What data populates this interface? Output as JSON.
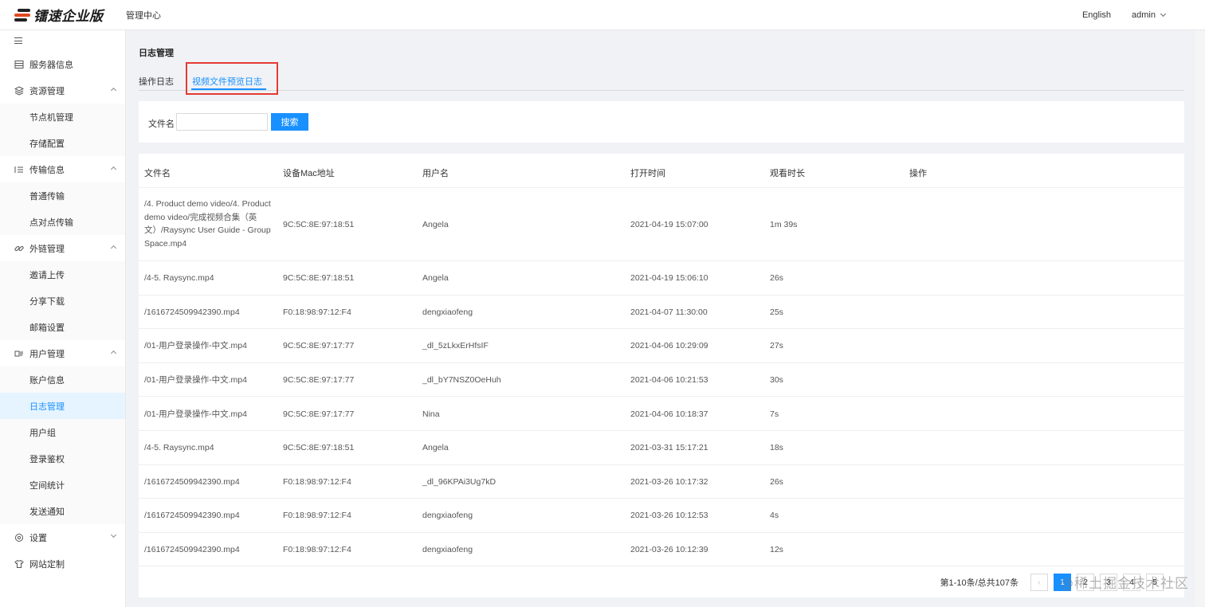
{
  "header": {
    "logo_text": "镭速企业版",
    "title": "管理中心",
    "language": "English",
    "user": "admin"
  },
  "sidebar": {
    "items": [
      {
        "label": "服务器信息",
        "icon": "server-icon",
        "level": 1
      },
      {
        "label": "资源管理",
        "icon": "layers-icon",
        "level": 1,
        "expanded": true
      },
      {
        "label": "节点机管理",
        "level": 2
      },
      {
        "label": "存储配置",
        "level": 2
      },
      {
        "label": "传输信息",
        "icon": "list-icon",
        "level": 1,
        "expanded": true
      },
      {
        "label": "普通传输",
        "level": 2
      },
      {
        "label": "点对点传输",
        "level": 2
      },
      {
        "label": "外链管理",
        "icon": "link-icon",
        "level": 1,
        "expanded": true
      },
      {
        "label": "邀请上传",
        "level": 2
      },
      {
        "label": "分享下载",
        "level": 2
      },
      {
        "label": "邮箱设置",
        "level": 2
      },
      {
        "label": "用户管理",
        "icon": "users-icon",
        "level": 1,
        "expanded": true
      },
      {
        "label": "账户信息",
        "level": 2
      },
      {
        "label": "日志管理",
        "level": 2,
        "active": true
      },
      {
        "label": "用户组",
        "level": 2
      },
      {
        "label": "登录鉴权",
        "level": 2
      },
      {
        "label": "空间统计",
        "level": 2
      },
      {
        "label": "发送通知",
        "level": 2
      },
      {
        "label": "设置",
        "icon": "gear-icon",
        "level": 1,
        "expanded": false
      },
      {
        "label": "网站定制",
        "icon": "shirt-icon",
        "level": 1
      }
    ]
  },
  "page": {
    "title": "日志管理",
    "tabs": [
      {
        "label": "操作日志"
      },
      {
        "label": "视频文件预览日志",
        "active": true
      }
    ]
  },
  "search": {
    "label": "文件名",
    "value": "",
    "button": "搜索"
  },
  "table": {
    "columns": [
      "文件名",
      "设备Mac地址",
      "用户名",
      "打开时间",
      "观看时长",
      "操作"
    ],
    "rows": [
      {
        "file": "/4. Product demo video/4. Product demo video/完成视频合集（英文）/Raysync User Guide - Group Space.mp4",
        "mac": "9C:5C:8E:97:18:51",
        "user": "Angela",
        "time": "2021-04-19 15:07:00",
        "duration": "1m 39s"
      },
      {
        "file": "/4-5. Raysync.mp4",
        "mac": "9C:5C:8E:97:18:51",
        "user": "Angela",
        "time": "2021-04-19 15:06:10",
        "duration": "26s"
      },
      {
        "file": "/1616724509942390.mp4",
        "mac": "F0:18:98:97:12:F4",
        "user": "dengxiaofeng",
        "time": "2021-04-07 11:30:00",
        "duration": "25s"
      },
      {
        "file": "/01-用户登录操作-中文.mp4",
        "mac": "9C:5C:8E:97:17:77",
        "user": "_dl_5zLkxErHfsIF",
        "time": "2021-04-06 10:29:09",
        "duration": "27s"
      },
      {
        "file": "/01-用户登录操作-中文.mp4",
        "mac": "9C:5C:8E:97:17:77",
        "user": "_dl_bY7NSZ0OeHuh",
        "time": "2021-04-06 10:21:53",
        "duration": "30s"
      },
      {
        "file": "/01-用户登录操作-中文.mp4",
        "mac": "9C:5C:8E:97:17:77",
        "user": "Nina",
        "time": "2021-04-06 10:18:37",
        "duration": "7s"
      },
      {
        "file": "/4-5. Raysync.mp4",
        "mac": "9C:5C:8E:97:18:51",
        "user": "Angela",
        "time": "2021-03-31 15:17:21",
        "duration": "18s"
      },
      {
        "file": "/1616724509942390.mp4",
        "mac": "F0:18:98:97:12:F4",
        "user": "_dl_96KPAi3Ug7kD",
        "time": "2021-03-26 10:17:32",
        "duration": "26s"
      },
      {
        "file": "/1616724509942390.mp4",
        "mac": "F0:18:98:97:12:F4",
        "user": "dengxiaofeng",
        "time": "2021-03-26 10:12:53",
        "duration": "4s"
      },
      {
        "file": "/1616724509942390.mp4",
        "mac": "F0:18:98:97:12:F4",
        "user": "dengxiaofeng",
        "time": "2021-03-26 10:12:39",
        "duration": "12s"
      }
    ]
  },
  "pagination": {
    "summary": "第1-10条/总共107条",
    "prev": "‹",
    "pages": [
      "1",
      "2",
      "3",
      "4",
      "5"
    ],
    "current": "1",
    "ellipsis": "···"
  },
  "watermark": "@稀土掘金技术社区",
  "colors": {
    "primary": "#1890ff",
    "highlight": "#e53935",
    "active_bg": "#e6f4ff"
  }
}
